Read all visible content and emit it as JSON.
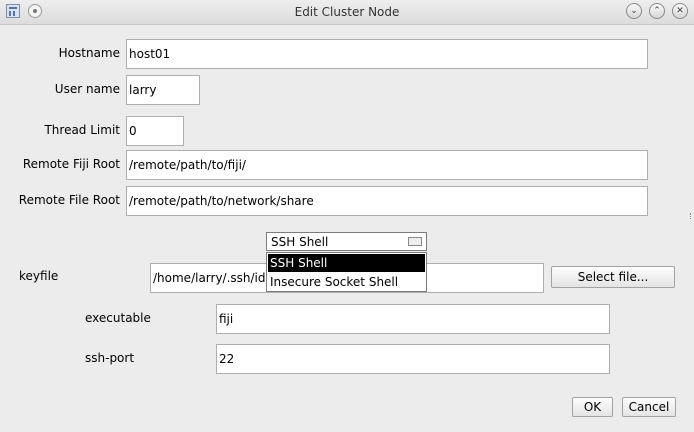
{
  "window": {
    "title": "Edit Cluster Node",
    "icons": [
      "window-menu-icon",
      "sticky-icon",
      "minimize-icon",
      "maximize-icon",
      "close-icon"
    ]
  },
  "form": {
    "hostname": {
      "label": "Hostname",
      "value": "host01"
    },
    "username": {
      "label": "User name",
      "value": "larry"
    },
    "thread_limit": {
      "label": "Thread Limit",
      "value": "0"
    },
    "fiji_root": {
      "label": "Remote Fiji Root",
      "value": "/remote/path/to/fiji/"
    },
    "file_root": {
      "label": "Remote File Root",
      "value": "/remote/path/to/network/share"
    }
  },
  "shell": {
    "selected": "SSH Shell",
    "options": [
      "SSH Shell",
      "Insecure Socket Shell"
    ]
  },
  "ssh": {
    "keyfile": {
      "label": "keyfile",
      "value": "/home/larry/.ssh/id"
    },
    "select_file_label": "Select file...",
    "executable": {
      "label": "executable",
      "value": "fiji"
    },
    "port": {
      "label": "ssh-port",
      "value": "22"
    }
  },
  "buttons": {
    "ok": "OK",
    "cancel": "Cancel"
  }
}
